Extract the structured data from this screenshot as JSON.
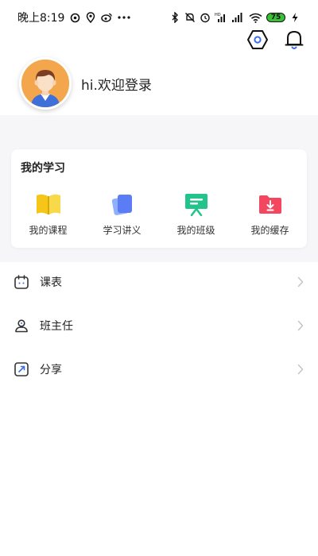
{
  "status_bar": {
    "time": "晚上8:19",
    "battery_level": "75",
    "network_badge": "HD"
  },
  "header": {
    "settings_icon": "settings-hexagon-icon",
    "notification_icon": "bell-icon"
  },
  "profile": {
    "greeting": "hi.欢迎登录",
    "avatar_icon": "avatar-boy-icon"
  },
  "my_study": {
    "title": "我的学习",
    "items": [
      {
        "label": "我的课程",
        "icon": "open-book-icon",
        "color": "#f5c518"
      },
      {
        "label": "学习讲义",
        "icon": "handout-cards-icon",
        "color": "#5b7cf5"
      },
      {
        "label": "我的班级",
        "icon": "blackboard-icon",
        "color": "#22c48c"
      },
      {
        "label": "我的缓存",
        "icon": "download-folder-icon",
        "color": "#f2475f"
      }
    ]
  },
  "menu": [
    {
      "label": "课表",
      "icon": "calendar-icon"
    },
    {
      "label": "班主任",
      "icon": "teacher-icon"
    },
    {
      "label": "分享",
      "icon": "share-icon"
    }
  ],
  "colors": {
    "accent_blue": "#3a6fe8",
    "background_band": "#f6f6f8",
    "chevron": "#c4c4c4"
  }
}
